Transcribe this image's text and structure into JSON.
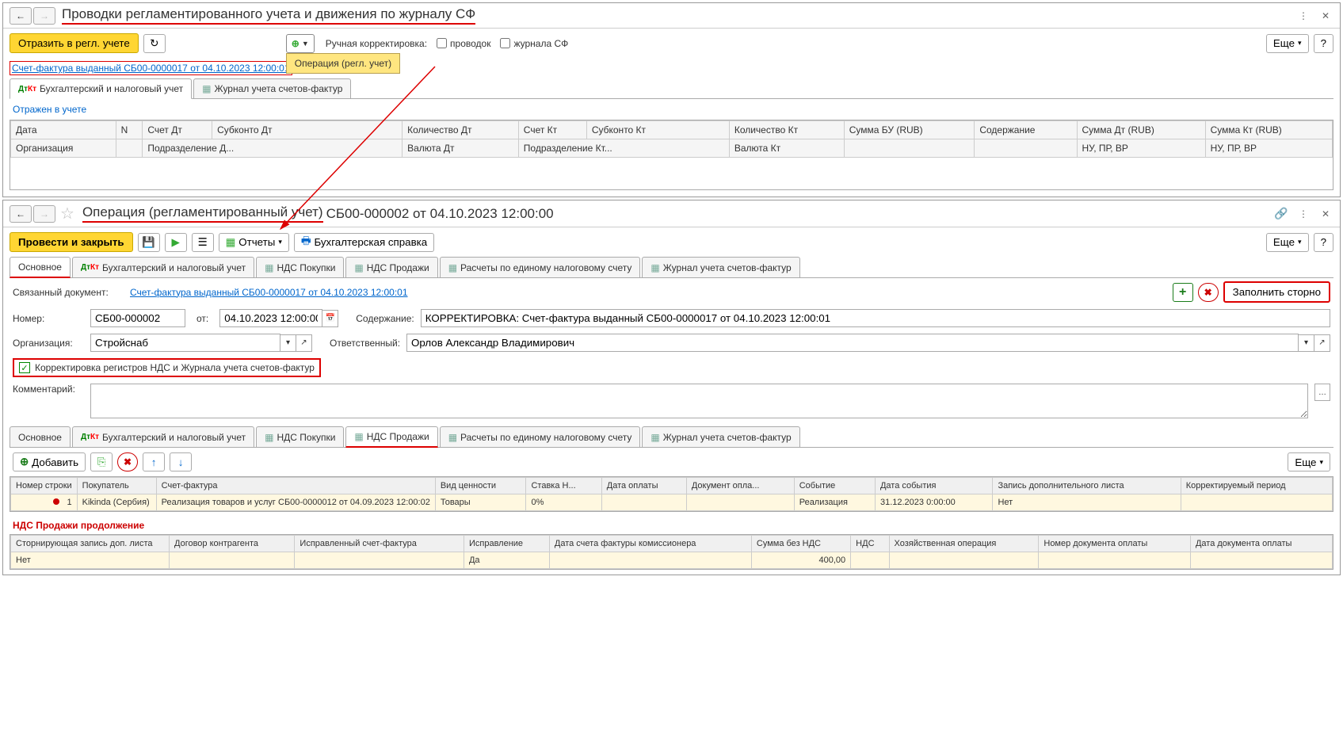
{
  "pane1": {
    "title_underlined": "Проводки регламентированного учета и движения по журналу СФ",
    "btn_reflect": "Отразить в регл. учете",
    "dropdown_item": "Операция (регл. учет)",
    "manual_label": "Ручная корректировка:",
    "chk_entries": "проводок",
    "chk_journal": "журнала СФ",
    "btn_more": "Еще",
    "btn_help": "?",
    "link": "Счет-фактура выданный СБ00-0000017 от 04.10.2023 12:00:01",
    "tab1": "Бухгалтерский и налоговый учет",
    "tab2": "Журнал учета счетов-фактур",
    "status": "Отражен в учете",
    "grid": {
      "r1": {
        "c1": "Дата",
        "c2": "N",
        "c3": "Счет Дт",
        "c4": "Субконто Дт",
        "c5": "Количество Дт",
        "c6": "Счет Кт",
        "c7": "Субконто Кт",
        "c8": "Количество Кт",
        "c9": "Сумма БУ (RUB)",
        "c10": "Содержание",
        "c11": "Сумма Дт (RUB)",
        "c12": "Сумма Кт (RUB)"
      },
      "r2": {
        "c1": "Организация",
        "c3": "Подразделение Д...",
        "c5": "Валюта Дт",
        "c6": "Подразделение Кт...",
        "c8": "Валюта Кт",
        "c11": "НУ, ПР, ВР",
        "c12": "НУ, ПР, ВР"
      }
    }
  },
  "pane2": {
    "title_underlined": "Операция (регламентированный учет)",
    "title_rest": " СБ00-000002 от 04.10.2023 12:00:00",
    "btn_post": "Провести и закрыть",
    "btn_reports": "Отчеты",
    "btn_acc_ref": "Бухгалтерская справка",
    "btn_more": "Еще",
    "btn_help": "?",
    "tabs": {
      "t1": "Основное",
      "t2": "Бухгалтерский и налоговый учет",
      "t3": "НДС Покупки",
      "t4": "НДС Продажи",
      "t5": "Расчеты по единому налоговому счету",
      "t6": "Журнал учета счетов-фактур"
    },
    "linked_label": "Связанный документ:",
    "linked_link": "Счет-фактура выданный СБ00-0000017 от 04.10.2023 12:00:01",
    "btn_fill_storno": "Заполнить сторно",
    "num_label": "Номер:",
    "num_val": "СБ00-000002",
    "from_label": "от:",
    "from_val": "04.10.2023 12:00:00",
    "content_label": "Содержание:",
    "content_val": "КОРРЕКТИРОВКА: Счет-фактура выданный СБ00-0000017 от 04.10.2023 12:00:01",
    "org_label": "Организация:",
    "org_val": "Стройснаб",
    "resp_label": "Ответственный:",
    "resp_val": "Орлов Александр Владимирович",
    "chk_corr": "Корректировка регистров НДС и Журнала учета счетов-фактур",
    "comment_label": "Комментарий:",
    "btn_add": "Добавить",
    "section2_title": "НДС Продажи продолжение",
    "table1": {
      "h": {
        "c1": "Номер строки",
        "c2": "Покупатель",
        "c3": "Счет-фактура",
        "c4": "Вид ценности",
        "c5": "Ставка Н...",
        "c6": "Дата оплаты",
        "c7": "Документ опла...",
        "c8": "Событие",
        "c9": "Дата события",
        "c10": "Запись дополнительного листа",
        "c11": "Корректируемый период"
      },
      "r": {
        "c1": "1",
        "c2": "Kikinda (Сербия)",
        "c3": "Реализация товаров и услуг СБ00-0000012 от 04.09.2023 12:00:02",
        "c4": "Товары",
        "c5": "0%",
        "c8": "Реализация",
        "c9": "31.12.2023 0:00:00",
        "c10": "Нет"
      }
    },
    "table2": {
      "h": {
        "c1": "Сторнирующая запись доп. листа",
        "c2": "Договор контрагента",
        "c3": "Исправленный счет-фактура",
        "c4": "Исправление",
        "c5": "Дата счета фактуры комиссионера",
        "c6": "Сумма без НДС",
        "c7": "НДС",
        "c8": "Хозяйственная операция",
        "c9": "Номер документа оплаты",
        "c10": "Дата документа оплаты"
      },
      "r": {
        "c1": "Нет",
        "c4": "Да",
        "c6": "400,00"
      }
    }
  }
}
